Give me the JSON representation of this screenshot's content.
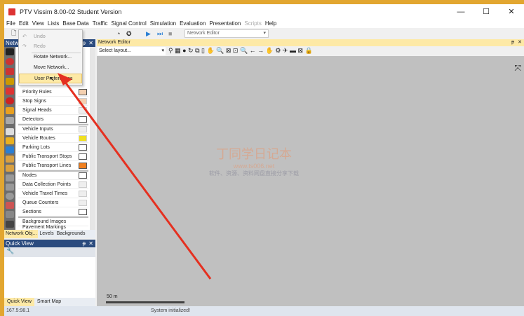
{
  "window": {
    "title": "PTV Vissim 8.00-02 Student Version",
    "min": "—",
    "max": "☐",
    "close": "✕"
  },
  "menubar": [
    "File",
    "Edit",
    "View",
    "Lists",
    "Base Data",
    "Traffic",
    "Signal Control",
    "Simulation",
    "Evaluation",
    "Presentation",
    "Scripts",
    "Help"
  ],
  "toolbar": {
    "layout_combo": "Network Editor"
  },
  "edit_menu": {
    "items": [
      {
        "label": "Undo",
        "enabled": false
      },
      {
        "label": "Redo",
        "enabled": false
      },
      {
        "label": "Rotate Network...",
        "enabled": true
      },
      {
        "label": "Move Network...",
        "enabled": true
      },
      {
        "label": "User Preferences",
        "enabled": true,
        "highlighted": true
      }
    ]
  },
  "network_objects": {
    "title": "Netw",
    "pin": "ᵽ",
    "close": "✕",
    "items": [
      "Priority Rules",
      "Stop Signs",
      "Signal Heads",
      "Detectors",
      "Vehicle Inputs",
      "Vehicle Routes",
      "Parking Lots",
      "Public Transport Stops",
      "Public Transport Lines",
      "Nodes",
      "Data Collection Points",
      "Vehicle Travel Times",
      "Queue Counters",
      "Sections",
      "Background Images",
      "Pavement Markings"
    ],
    "tabs": [
      "Network Obj...",
      "Levels",
      "Backgrounds"
    ]
  },
  "quick_view": {
    "title": "Quick View",
    "pin": "ᵽ",
    "close": "✕",
    "tabs": [
      "Quick View",
      "Smart Map"
    ]
  },
  "editor": {
    "title": "Network Editor",
    "layout_select": "Select layout...",
    "scale_label": "50 m",
    "pin": "ᵽ",
    "close": "✕"
  },
  "watermark": {
    "line1": "丁同学日记本",
    "line2": "www.ts006.net",
    "line3": "软件、资源、资料网盘直接分享下载"
  },
  "status": {
    "coords": "167.5:98.1",
    "message": "System initialized!"
  },
  "colors": {
    "accent": "#2b4b7e",
    "highlight": "#fde9a6",
    "arrow": "#e53020"
  }
}
